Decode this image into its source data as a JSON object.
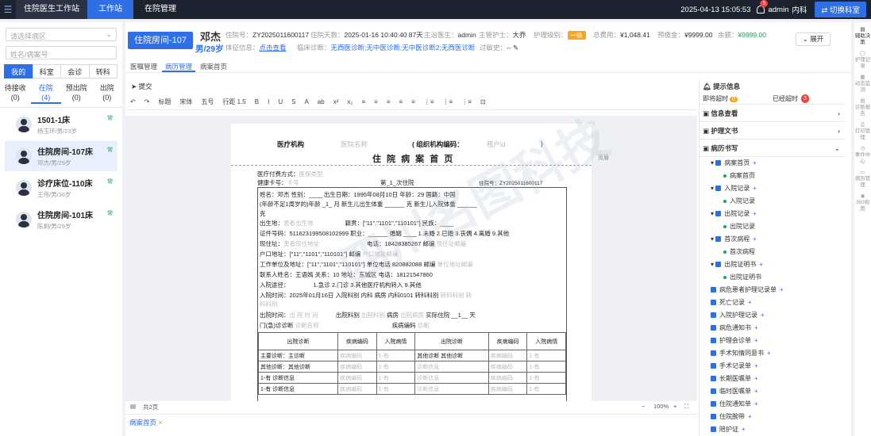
{
  "topbar": {
    "title": "住院医生工作站",
    "tabs": [
      "工作站",
      "在院管理"
    ],
    "datetime": "2025-04-13 15:05:53",
    "notif_count": "5",
    "user": "admin",
    "dept": "内科",
    "switch": "切换科室"
  },
  "left": {
    "ward_placeholder": "请选择病区",
    "search_placeholder": "姓名/病案号",
    "seg": [
      "我的",
      "科室",
      "会诊",
      "转科"
    ],
    "stats": [
      {
        "l": "待接收",
        "v": "(0)"
      },
      {
        "l": "在院",
        "v": "(4)"
      },
      {
        "l": "预出院",
        "v": "(0)"
      },
      {
        "l": "出院",
        "v": "(0)"
      }
    ],
    "patients": [
      {
        "name": "1501-1床",
        "sub": "杨玉环/男/23岁",
        "tag": "常"
      },
      {
        "name": "住院房间-107床",
        "sub": "邓杰/男/29岁",
        "tag": "常"
      },
      {
        "name": "诊疗床位-110床",
        "sub": "王伟/男/36岁",
        "tag": "常"
      },
      {
        "name": "住院房间-101床",
        "sub": "陈炯/男/29岁",
        "tag": "常"
      }
    ]
  },
  "header": {
    "bed": "住院房间-107",
    "name": "邓杰",
    "gender_age": "男/29岁",
    "hosp_no_k": "住院号：",
    "hosp_no": "ZY2025011600117",
    "days_k": "住院天数：",
    "days": "2025-01-16 10:40:40 87天",
    "doc_k": "主治医生：",
    "doc": "admin",
    "nurse_k": "主管护士：",
    "nurse": "大乔",
    "level_k": "护理级别：",
    "level": "一级",
    "total_k": "总费用：",
    "total": "¥1,048.41",
    "prepay_k": "预缴金：",
    "prepay": "¥9999.00",
    "balance_k": "余额：",
    "balance": "¥9999.00",
    "vitals_k": "体征信息：",
    "vitals": "点击查看",
    "diag_k": "临床诊断：",
    "diag": "无西医诊断;无中医诊断;无中医诊断2;无西医诊断",
    "allergy_k": "过敏史：",
    "allergy": "--",
    "expand": "展开"
  },
  "subtabs": [
    "医嘱管理",
    "病历管理",
    "病案首页"
  ],
  "editor": {
    "submit": "提交",
    "toolbar": [
      "↶",
      "↷",
      "标题",
      "宋体",
      "五号",
      "行距 1.5",
      "B",
      "I",
      "U",
      "S",
      "A",
      "ab",
      "x²",
      "x₂",
      "≡",
      "≡",
      "≡",
      "≡",
      "≡",
      "⋮≡",
      "⋮≡",
      "⋮≡",
      "⊡"
    ],
    "pages": "共2页",
    "zoom": "100%",
    "sidebar_label": "页眉"
  },
  "doc": {
    "org": "医疗机构",
    "org_ph": "医院名称",
    "org_code": "( 组织机构编码：",
    "org_code_ph": "租户id",
    "title": "住 院 病 案 首 页",
    "pay": "医疗付费方式：",
    "pay_ph": "医保类型",
    "card": "健康卡号：",
    "card_ph": "卡号",
    "times": "第_1_次住院",
    "no": "住院号：ZY2025011600117",
    "r1": "姓名：邓杰    性别：____   出生日期：1995年08月10日   年龄：29    国籍：中国",
    "r2": "(年龄不足1周岁的)年龄  _1_  月   新生儿出生体重 ______  克  新生儿入院体重 ______",
    "r2b": "克",
    "r3": "出生地：",
    "r3ph": "患者出生地",
    "r3b": "籍贯：[\"11\",\"1101\",\"110101\"]   民族：____",
    "r4": "证件号码：511623199508102999    职业：______   婚姻 ____ 1.未婚 2.已婚 3.丧偶 4.离婚 9.其他",
    "r5": "现住址：",
    "r5ph": "患者现住地址",
    "r5b": "电话：18428385267     邮编",
    "r5c": "现住址邮编",
    "r6": "户口地址：[\"11\",\"1101\",\"110101\"]                  邮编",
    "r6b": "户口地址邮编",
    "r7": "工作单位及地址：[\"11\",\"1101\",\"110101\"]        单位电话  820882088     邮编",
    "r7b": "单位地址邮编",
    "r8": "联系人姓名：王语嫣   关系：10     地址：东城区                    电话：18121547860",
    "r9": "入院途径：",
    "r9b": "1.急诊 2.门诊 3.其他医疗机构转入 9.其他",
    "r10": "入院时间：2025年01月16日  入院科别  内科     病房  内科0101     转科科别",
    "r10b": "转科科别",
    "r10c": "转",
    "r10d": "科科别",
    "r11": "出院时间：",
    "r11ph": "出 院 时 间",
    "r11b": "出院科别",
    "r11c": "出院科别",
    "r11d": "病房",
    "r11e": "出院病房",
    "r11f": "实际住院 __1__ 天",
    "r12": "门(急)诊诊断",
    "r12ph": "诊断名称",
    "r12b": "疾病编码",
    "r12c": "诊断",
    "th": [
      "出院诊断",
      "疾病编码",
      "入院病情",
      "出院诊断",
      "疾病编码",
      "入院病情"
    ],
    "rows": [
      [
        "主要诊断：主诊断",
        "疾病编码",
        "1-有",
        "其他诊断  其他诊断",
        "疾病编码",
        "1-有"
      ],
      [
        "其他诊断：其他诊断",
        "疾病编码",
        "1-有",
        "诊断信息",
        "疾病编码",
        "1-有"
      ],
      [
        "1-有  诊断信息",
        "疾病编码",
        "1-有",
        "诊断信息",
        "疾病编码",
        "1-有"
      ],
      [
        "1-有  诊断信息",
        "疾病编码",
        "1-有",
        "诊断信息",
        "疾病编码",
        "1-有"
      ]
    ],
    "watermark": "四川名图科技"
  },
  "right": {
    "title": "提示信息",
    "timeout": "即将超时",
    "timeout_n": "0",
    "over": "已经超时",
    "over_n": "3",
    "sections": [
      "信息查看",
      "护理文书",
      "病历书写"
    ],
    "tree": [
      {
        "p": "病案首页",
        "c": "病案首页"
      },
      {
        "p": "入院记录",
        "c": "入院记录"
      },
      {
        "p": "出院记录",
        "c": "出院记录"
      },
      {
        "p": "首次病程",
        "c": "首次病程"
      },
      {
        "p": "出院证明书",
        "c": "出院证明书"
      }
    ],
    "items": [
      "病危患者护理记录单",
      "死亡记录",
      "入院护理记录",
      "病危通知书",
      "护理会诊单",
      "手术知情同意书",
      "手术记录单",
      "长期医嘱单",
      "临时医嘱单",
      "住院通知单",
      "住院腕带",
      "陪护证"
    ]
  },
  "rightbar": [
    "辅助决策",
    "护理记录",
    "动态监测",
    "诊断报告",
    "打印管理",
    "事件中心",
    "病历管理",
    "360视图"
  ],
  "bottom_tab": "病案首页"
}
